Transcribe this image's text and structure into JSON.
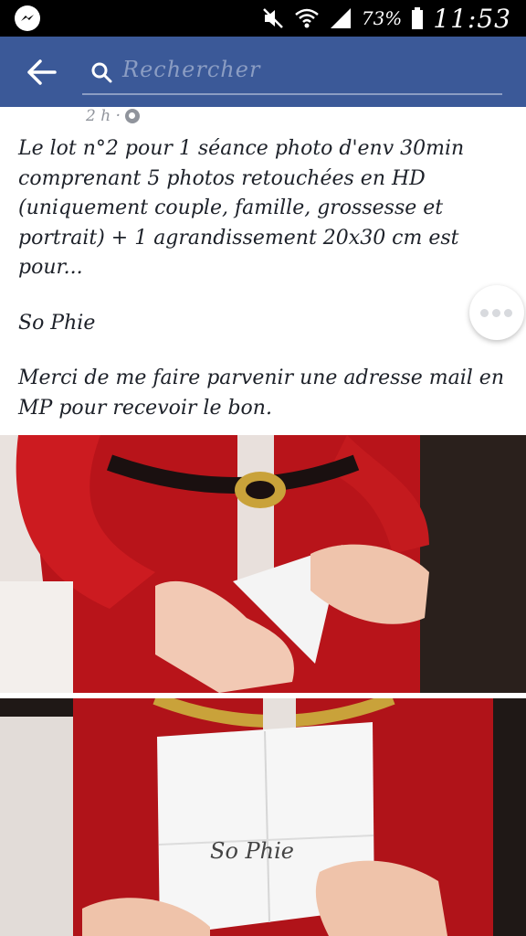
{
  "status_bar": {
    "battery_percent": "73%",
    "time": "11:53",
    "icons": [
      "messenger-icon",
      "mute-icon",
      "wifi-icon",
      "signal-icon",
      "battery-icon"
    ]
  },
  "app_bar": {
    "search_placeholder": "Rechercher",
    "icons": [
      "back-arrow-icon",
      "search-icon"
    ],
    "color": "#3b5998"
  },
  "post": {
    "timestamp": "2 h ·",
    "paragraphs": [
      "Le lot n°2 pour 1 séance photo d'env 30min comprenant 5 photos retouchées en HD (uniquement couple, famille, grossesse et portrait) + 1 agrandissement 20x30 cm est pour...",
      "So Phie",
      "Merci de me faire parvenir une adresse mail en MP pour recevoir le bon."
    ],
    "photo_note_text": "So Phie"
  }
}
